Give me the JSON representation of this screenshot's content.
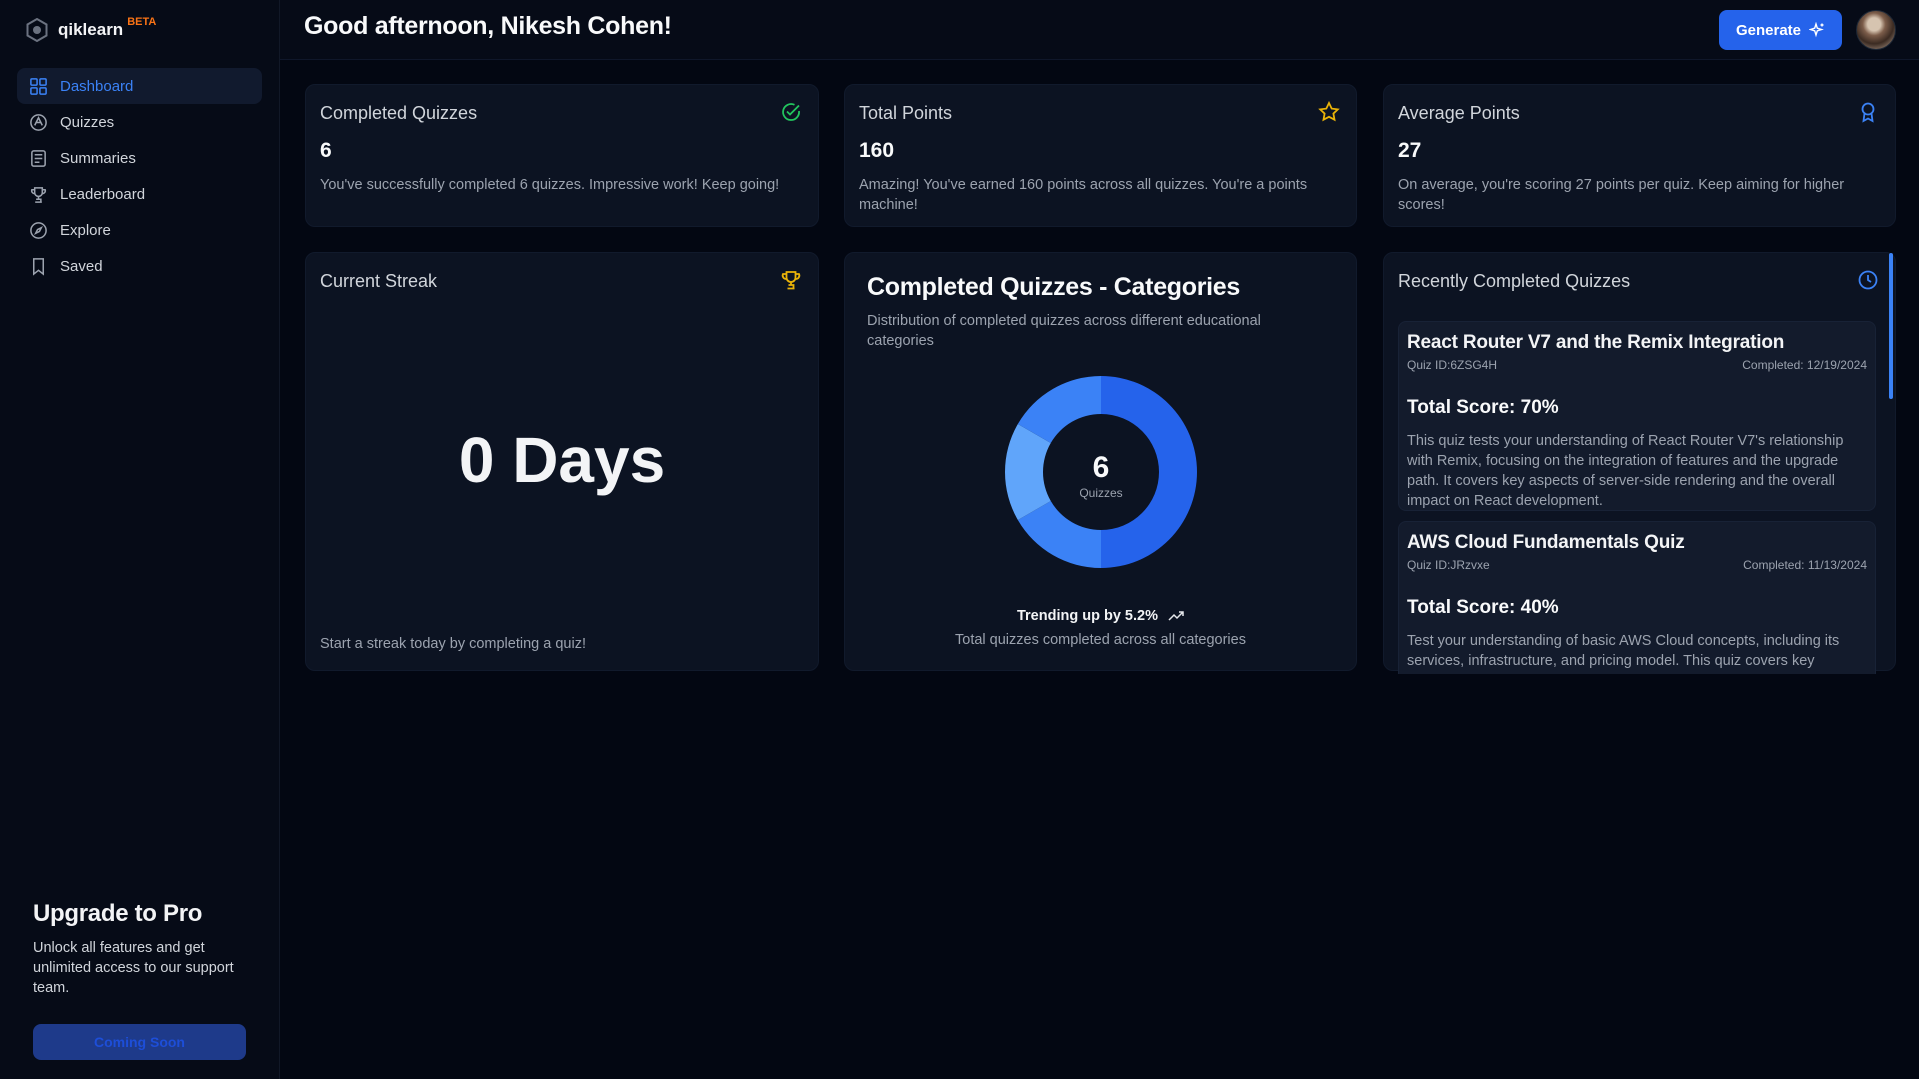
{
  "brand": {
    "name": "qiklearn",
    "badge": "BETA"
  },
  "sidebar": {
    "items": [
      {
        "label": "Dashboard",
        "icon": "dashboard-icon",
        "active": true
      },
      {
        "label": "Quizzes",
        "icon": "quiz-icon"
      },
      {
        "label": "Summaries",
        "icon": "summaries-icon"
      },
      {
        "label": "Leaderboard",
        "icon": "trophy-icon"
      },
      {
        "label": "Explore",
        "icon": "compass-icon"
      },
      {
        "label": "Saved",
        "icon": "bookmark-icon"
      }
    ],
    "upgrade": {
      "title": "Upgrade to Pro",
      "text": "Unlock all features and get unlimited access to our support team.",
      "button": "Coming Soon"
    }
  },
  "header": {
    "greeting": "Good afternoon, Nikesh Cohen!",
    "generate_label": "Generate"
  },
  "stats": [
    {
      "title": "Completed Quizzes",
      "value": "6",
      "description": "You've successfully completed 6 quizzes. Impressive work! Keep going!",
      "icon": "check-circle-icon",
      "icon_color": "#22c55e"
    },
    {
      "title": "Total Points",
      "value": "160",
      "description": "Amazing! You've earned 160 points across all quizzes. You're a points machine!",
      "icon": "star-icon",
      "icon_color": "#eab308"
    },
    {
      "title": "Average Points",
      "value": "27",
      "description": "On average, you're scoring 27 points per quiz. Keep aiming for higher scores!",
      "icon": "award-icon",
      "icon_color": "#3b82f6"
    }
  ],
  "streak": {
    "title": "Current Streak",
    "value": "0 Days",
    "footer": "Start a streak today by completing a quiz!",
    "icon": "trophy-icon",
    "icon_color": "#eab308"
  },
  "categories_chart": {
    "title": "Completed Quizzes - Categories",
    "subtitle": "Distribution of completed quizzes across different educational categories",
    "center_value": "6",
    "center_label": "Quizzes",
    "trend": "Trending up by 5.2%",
    "footer": "Total quizzes completed across all categories"
  },
  "chart_data": {
    "type": "pie",
    "donut": true,
    "total": 6,
    "values": [
      3,
      1,
      1,
      1
    ],
    "colors": [
      "#2563eb",
      "#3b82f6",
      "#60a5fa",
      "#3b82f6"
    ]
  },
  "recent": {
    "title": "Recently Completed Quizzes",
    "icon": "clock-icon",
    "quizzes": [
      {
        "title": "React Router V7 and the Remix Integration",
        "id": "Quiz ID:6ZSG4H",
        "completed": "Completed: 12/19/2024",
        "score": "Total Score: 70%",
        "description": "This quiz tests your understanding of React Router V7's relationship with Remix, focusing on the integration of features and the upgrade path. It covers key aspects of server-side rendering and the overall impact on React development."
      },
      {
        "title": "AWS Cloud Fundamentals Quiz",
        "id": "Quiz ID:JRzvxe",
        "completed": "Completed: 11/13/2024",
        "score": "Total Score: 40%",
        "description": "Test your understanding of basic AWS Cloud concepts, including its services, infrastructure, and pricing model. This quiz covers key information for a cloud practitioner on AWS."
      }
    ]
  },
  "colors": {
    "accent": "#2563eb",
    "background": "#030712",
    "card": "#0c1322"
  }
}
